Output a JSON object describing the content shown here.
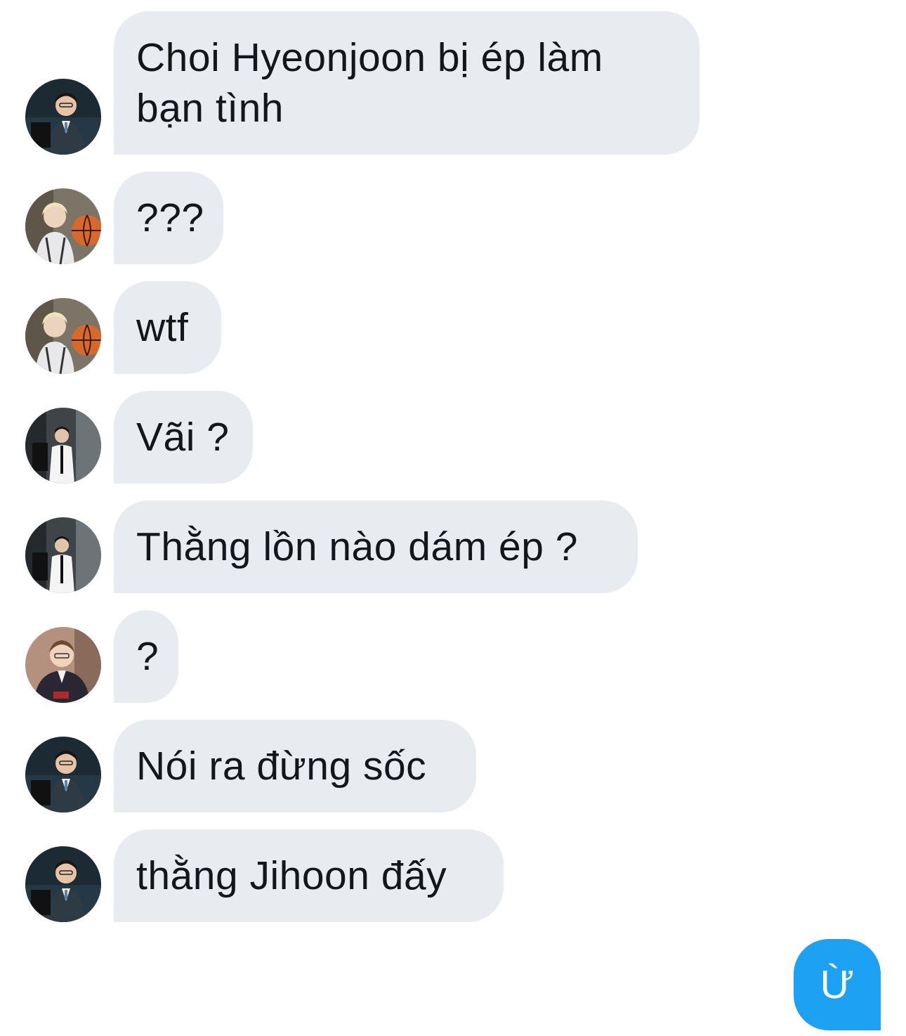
{
  "conversation": {
    "messages": [
      {
        "avatar": "avatar-a",
        "text": "Choi Hyeonjoon bị ép làm\nbạn tình"
      },
      {
        "avatar": "avatar-b",
        "text": "???"
      },
      {
        "avatar": "avatar-b",
        "text": "wtf"
      },
      {
        "avatar": "avatar-c",
        "text": "Vãi ?"
      },
      {
        "avatar": "avatar-c",
        "text": "Thằng lồn nào dám ép ?"
      },
      {
        "avatar": "avatar-d",
        "text": "?"
      },
      {
        "avatar": "avatar-a",
        "text": "Nói ra đừng sốc"
      },
      {
        "avatar": "avatar-a",
        "text": "thằng Jihoon đấy"
      }
    ],
    "outgoing": {
      "text": "Ừ"
    }
  },
  "colors": {
    "incoming_bubble": "#e8ecf0",
    "outgoing_bubble": "#1da1f2",
    "text": "#14171a"
  }
}
